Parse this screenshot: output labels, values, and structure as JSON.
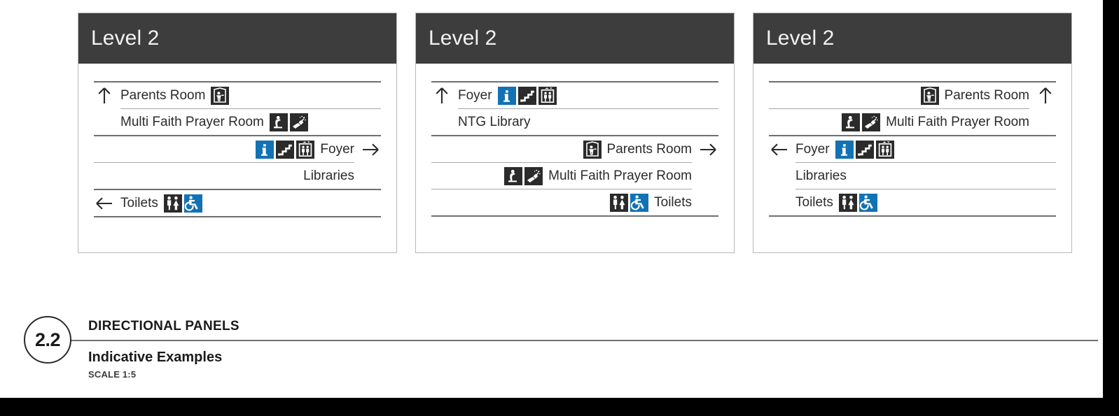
{
  "sheet": {
    "background": "#ffffff",
    "frame_color": "#000000"
  },
  "colors": {
    "header_bar": "#3d3d3d",
    "header_text": "#f2f2f2",
    "body_text": "#2b2b2b",
    "rule_thick": "#6f6f6f",
    "rule_thin": "#a8a8a8",
    "pictogram_dark": "#2b2b2b",
    "pictogram_blue": "#1272b4",
    "panel_border": "#b9b9b9"
  },
  "panels": [
    {
      "id": "panel-1",
      "title": "Level 2",
      "align": "left",
      "groups": [
        {
          "arrow": "arrow-up",
          "arrow_row": 0,
          "rows": [
            {
              "label": "Parents Room",
              "icons": [
                "parents-room-icon"
              ]
            },
            {
              "label": "Multi Faith Prayer Room",
              "icons": [
                "prayer-kneeling-icon",
                "ablution-wash-icon"
              ]
            }
          ]
        },
        {
          "arrow": "arrow-right",
          "arrow_row": 0,
          "align": "right",
          "rows": [
            {
              "label": "Foyer",
              "icons": [
                "information-icon",
                "stairs-icon",
                "lift-icon"
              ]
            },
            {
              "label": "Libraries",
              "icons": []
            }
          ]
        },
        {
          "arrow": "arrow-left",
          "arrow_row": 0,
          "rows": [
            {
              "label": "Toilets",
              "icons": [
                "toilets-icon",
                "accessible-icon"
              ]
            }
          ]
        }
      ]
    },
    {
      "id": "panel-2",
      "title": "Level 2",
      "align": "mixed",
      "groups": [
        {
          "arrow": "arrow-up",
          "arrow_row": 0,
          "rows": [
            {
              "label": "Foyer",
              "icons": [
                "information-icon",
                "stairs-icon",
                "lift-icon"
              ]
            },
            {
              "label": "NTG Library",
              "icons": []
            }
          ]
        },
        {
          "arrow": "arrow-right",
          "arrow_row": 0,
          "align": "right",
          "rows": [
            {
              "label": "Parents Room",
              "icons": [
                "parents-room-icon"
              ]
            },
            {
              "label": "Multi Faith Prayer Room",
              "icons": [
                "prayer-kneeling-icon",
                "ablution-wash-icon"
              ]
            },
            {
              "label": "Toilets",
              "icons": [
                "toilets-icon",
                "accessible-icon"
              ]
            }
          ]
        }
      ]
    },
    {
      "id": "panel-3",
      "title": "Level 2",
      "align": "mixed",
      "groups": [
        {
          "arrow": "arrow-up",
          "arrow_row": 0,
          "align": "right",
          "rows": [
            {
              "label": "Parents Room",
              "icons": [
                "parents-room-icon"
              ]
            },
            {
              "label": "Multi Faith Prayer Room",
              "icons": [
                "prayer-kneeling-icon",
                "ablution-wash-icon"
              ]
            }
          ]
        },
        {
          "arrow": "arrow-left",
          "arrow_row": 0,
          "rows": [
            {
              "label": "Foyer",
              "icons": [
                "information-icon",
                "stairs-icon",
                "lift-icon"
              ]
            },
            {
              "label": "Libraries",
              "icons": []
            },
            {
              "label": "Toilets",
              "icons": [
                "toilets-icon",
                "accessible-icon"
              ]
            }
          ]
        }
      ]
    }
  ],
  "caption": {
    "number": "2.2",
    "title": "DIRECTIONAL PANELS",
    "subtitle": "Indicative Examples",
    "scale": "SCALE 1:5"
  },
  "icon_names": {
    "parents-room-icon": "parents-room-icon",
    "prayer-kneeling-icon": "prayer-kneeling-icon",
    "ablution-wash-icon": "ablution-wash-icon",
    "information-icon": "information-icon",
    "stairs-icon": "stairs-icon",
    "lift-icon": "lift-icon",
    "toilets-icon": "toilets-icon",
    "accessible-icon": "accessible-icon",
    "arrow-up": "arrow-up-icon",
    "arrow-left": "arrow-left-icon",
    "arrow-right": "arrow-right-icon"
  }
}
